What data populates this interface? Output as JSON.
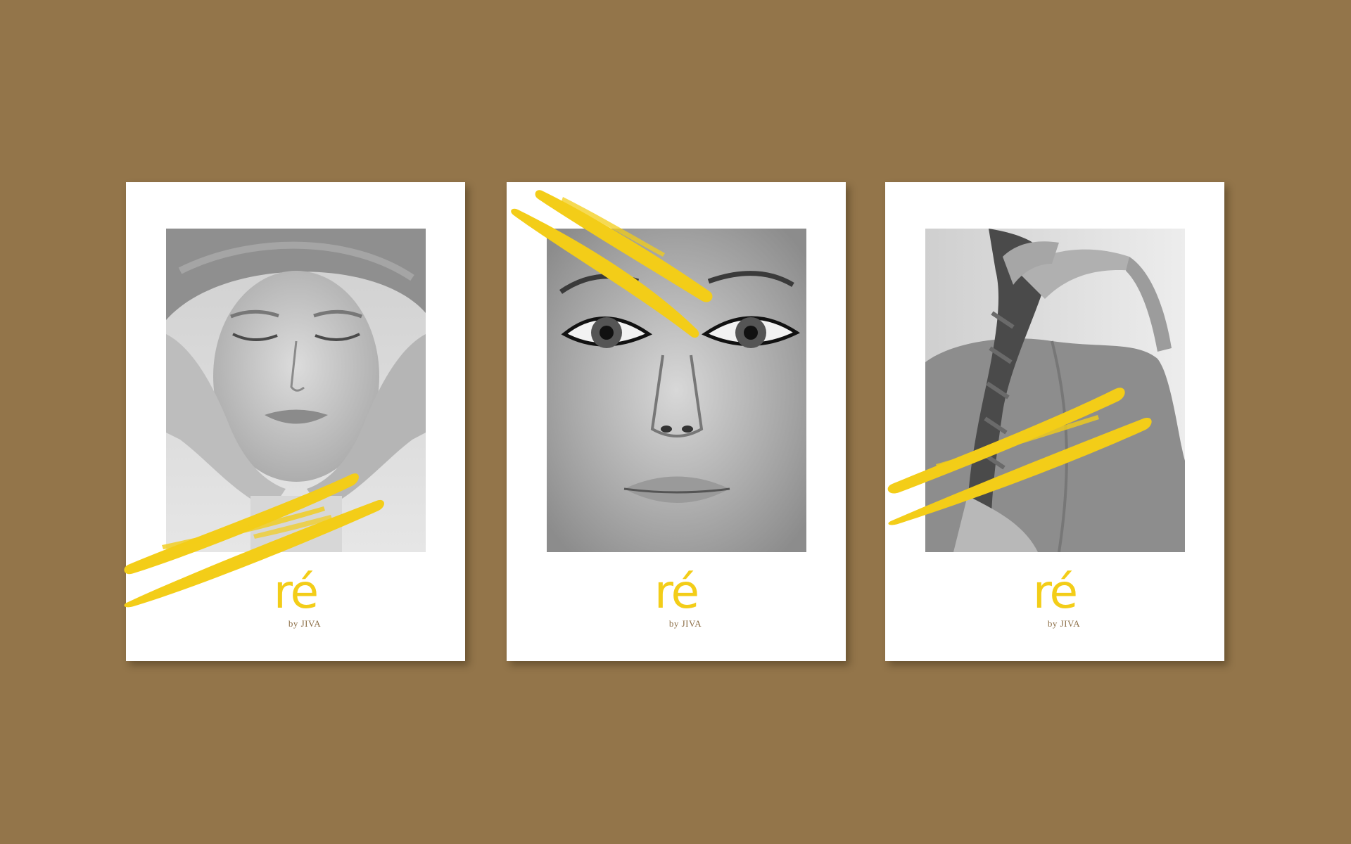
{
  "colors": {
    "background": "#93754a",
    "card": "#ffffff",
    "accent_yellow": "#f3cd18",
    "logo_sub": "#8b6d45"
  },
  "cards": [
    {
      "photo_icon": "face-massage-photo",
      "logo_mark": "ré",
      "logo_sub": "by JIVA"
    },
    {
      "photo_icon": "face-portrait-photo",
      "logo_mark": "ré",
      "logo_sub": "by JIVA"
    },
    {
      "photo_icon": "back-braid-photo",
      "logo_mark": "ré",
      "logo_sub": "by JIVA"
    }
  ]
}
